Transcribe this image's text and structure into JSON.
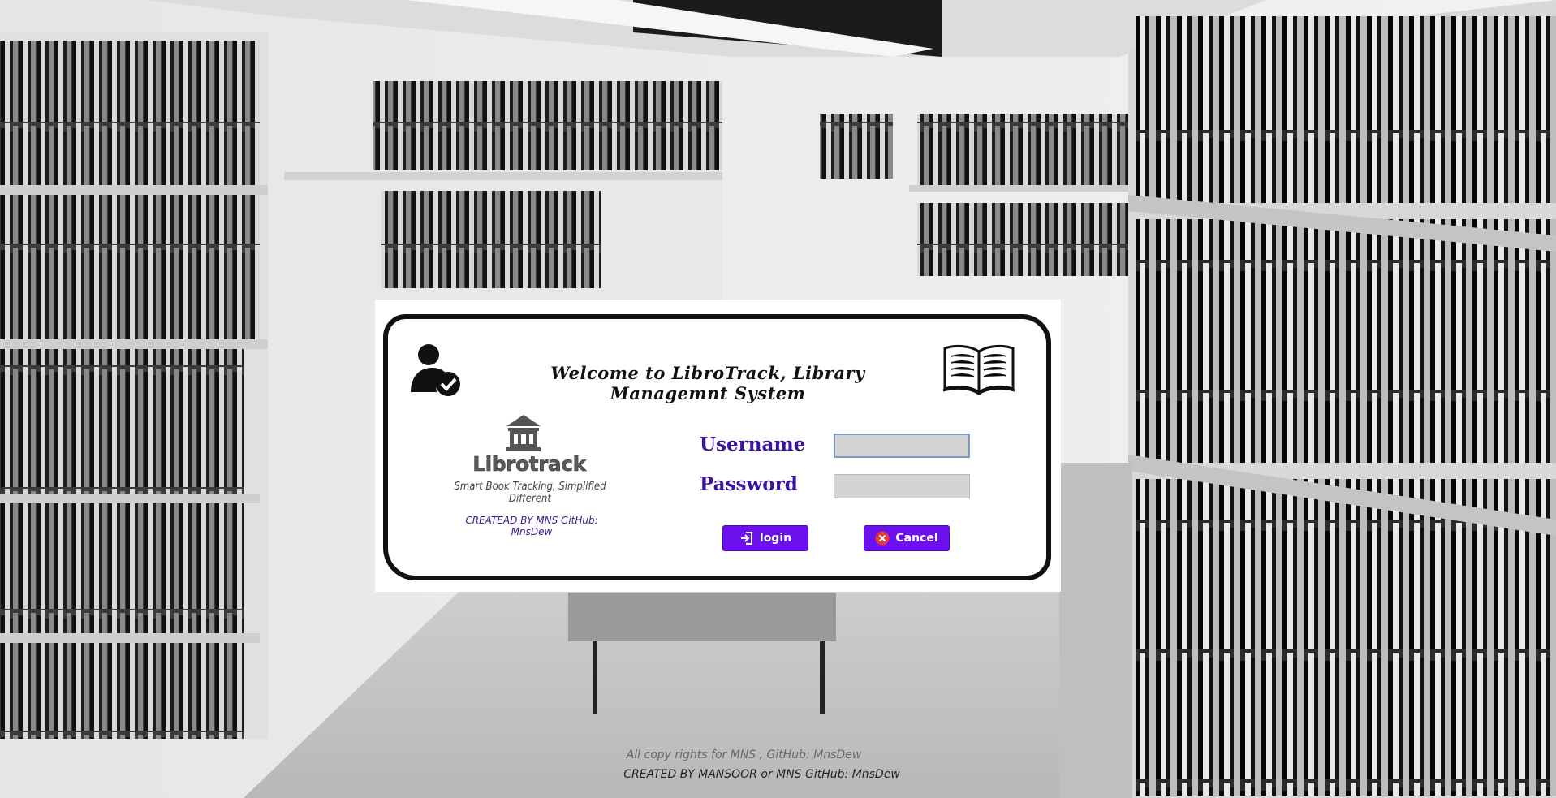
{
  "card": {
    "welcome": "Welcome to LibroTrack, Library Managemnt System",
    "logo_name": "Librotrack",
    "logo_tagline": "Smart Book Tracking, Simplified Different",
    "created_note": "CREATEAD BY MNS GitHub: MnsDew"
  },
  "form": {
    "username_label": "Username",
    "password_label": "Password",
    "username_value": "",
    "password_value": "",
    "login_label": "login",
    "cancel_label": "Cancel"
  },
  "footer": {
    "line1": "All copy rights for MNS , GitHub: MnsDew",
    "line2": "CREATED BY MANSOOR or MNS GitHub: MnsDew"
  },
  "icons": {
    "user": "user-check-icon",
    "book": "open-book-icon",
    "logo": "library-building-icon",
    "login": "sign-in-icon",
    "cancel": "cancel-x-icon"
  },
  "colors": {
    "accent": "#6d10f0",
    "label": "#3a12a0",
    "cancel_icon": "#e53935"
  }
}
